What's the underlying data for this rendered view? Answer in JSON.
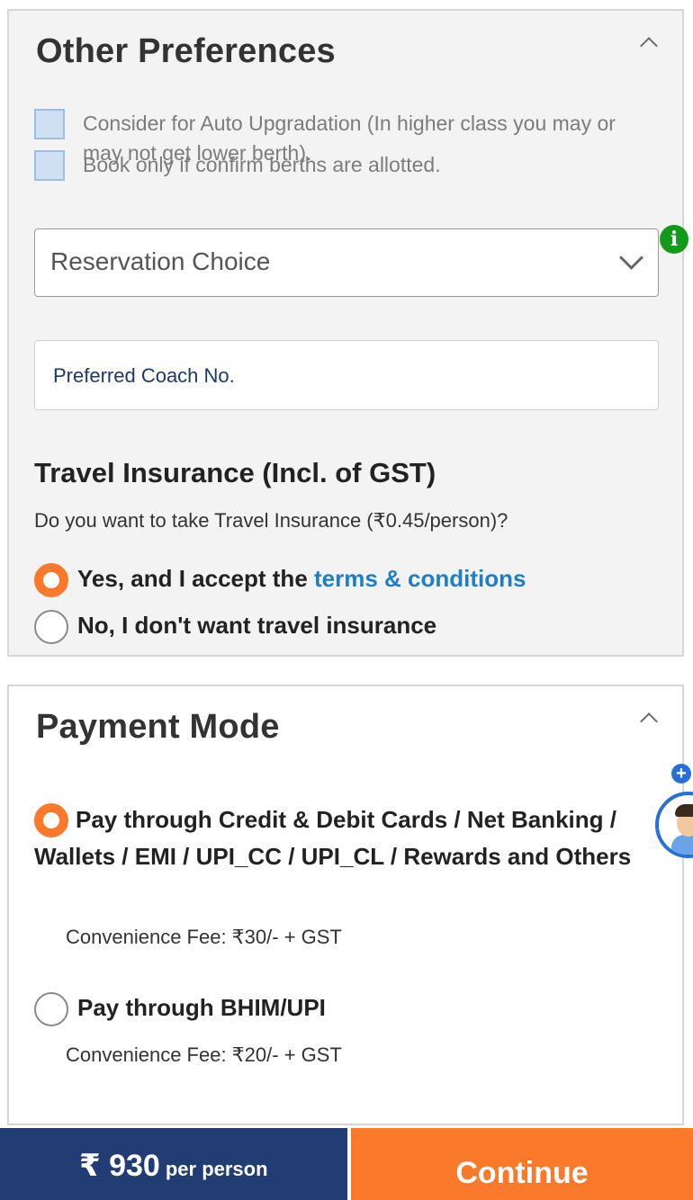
{
  "other_preferences": {
    "title": "Other Preferences",
    "collapse_icon": "chevron-up-icon",
    "auto_upgrade": {
      "label": "Consider for Auto Upgradation (In higher class you may or may not get lower berth).",
      "checked": false
    },
    "confirm_berths": {
      "label": "Book only if confirm berths are allotted.",
      "checked": false
    },
    "reservation_choice": {
      "value": "Reservation Choice",
      "icon": "chevron-down-icon",
      "info_icon": "info-icon"
    },
    "preferred_coach": {
      "placeholder": "Preferred Coach No."
    },
    "travel_insurance": {
      "title": "Travel Insurance (Incl. of GST)",
      "question": "Do you want to take Travel Insurance (₹0.45/person)?",
      "yes_prefix": "Yes, and I accept the ",
      "yes_link": "terms & conditions",
      "no_label": "No, I don't want travel insurance",
      "selected": "yes"
    }
  },
  "payment_mode": {
    "title": "Payment Mode",
    "collapse_icon": "chevron-up-icon",
    "options": [
      {
        "label": "Pay through Credit & Debit Cards / Net Banking / Wallets / EMI / UPI_CC / UPI_CL / Rewards and Others",
        "fee": "Convenience Fee: ₹30/- + GST",
        "selected": true
      },
      {
        "label": "Pay through BHIM/UPI",
        "fee": "Convenience Fee: ₹20/- + GST",
        "selected": false
      }
    ]
  },
  "assistant": {
    "plus_icon": "plus-icon",
    "avatar_icon": "assistant-avatar-icon"
  },
  "footer": {
    "price": "₹ 930",
    "price_unit": "per person",
    "continue_label": "Continue"
  },
  "colors": {
    "accent_orange": "#fb792b",
    "navy": "#213d73",
    "link_blue": "#1f7fc6",
    "info_green": "#139a1b"
  }
}
